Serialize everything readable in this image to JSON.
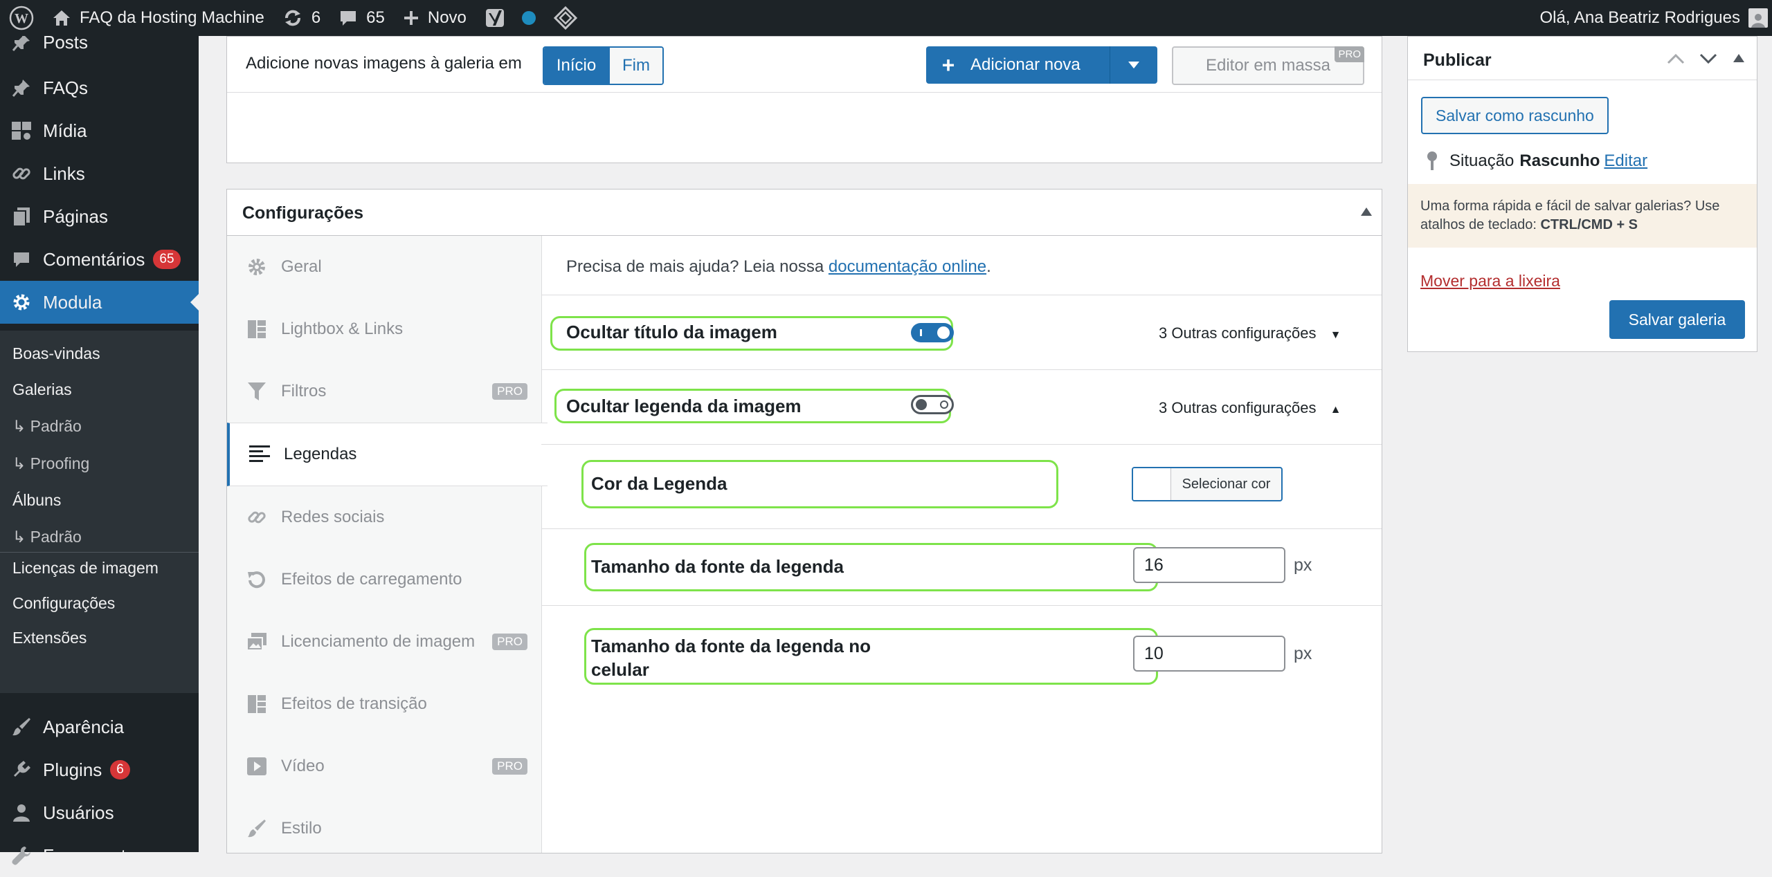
{
  "adminbar": {
    "site_name": "FAQ da Hosting Machine",
    "updates_count": "6",
    "comments_count": "65",
    "new_label": "Novo",
    "greeting": "Olá, Ana Beatriz Rodrigues"
  },
  "menu": {
    "posts": "Posts",
    "faqs": "FAQs",
    "midia": "Mídia",
    "links": "Links",
    "paginas": "Páginas",
    "comentarios": "Comentários",
    "comentarios_badge": "65",
    "modula": "Modula",
    "submenu": {
      "boas_vindas": "Boas-vindas",
      "galerias": "Galerias",
      "padrao1": "↳ Padrão",
      "proofing": "↳ Proofing",
      "albuns": "Álbuns",
      "padrao2": "↳ Padrão",
      "licencas": "Licenças de imagem",
      "configuracoes": "Configurações",
      "extensoes": "Extensões"
    },
    "aparencia": "Aparência",
    "plugins": "Plugins",
    "plugins_badge": "6",
    "usuarios": "Usuários",
    "ferramentas": "Ferramentas"
  },
  "gallery_toolbar": {
    "add_images_text": "Adicione novas imagens à galeria em",
    "inicio": "Início",
    "fim": "Fim",
    "add_new": "Adicionar nova",
    "bulk_editor": "Editor em massa",
    "pro": "PRO"
  },
  "config": {
    "title": "Configurações",
    "help_text": "Precisa de mais ajuda? Leia nossa ",
    "help_link": "documentação online",
    "help_end": ".",
    "tabs": [
      {
        "label": "Geral"
      },
      {
        "label": "Lightbox & Links"
      },
      {
        "label": "Filtros",
        "pro": "PRO"
      },
      {
        "label": "Legendas"
      },
      {
        "label": "Redes sociais"
      },
      {
        "label": "Efeitos de carregamento"
      },
      {
        "label": "Licenciamento de imagem",
        "pro": "PRO"
      },
      {
        "label": "Efeitos de transição"
      },
      {
        "label": "Vídeo",
        "pro": "PRO"
      },
      {
        "label": "Estilo"
      }
    ],
    "settings": {
      "hide_title": "Ocultar título da imagem",
      "hide_title_on": true,
      "hide_caption": "Ocultar legenda da imagem",
      "hide_caption_on": false,
      "other_settings": "3 Outras configurações",
      "caption_color": "Cor da Legenda",
      "select_color": "Selecionar cor",
      "font_size": "Tamanho da fonte da legenda",
      "font_size_value": "16",
      "mobile_font_size": "Tamanho da fonte da legenda no celular",
      "mobile_font_size_value": "10",
      "unit": "px"
    }
  },
  "publish": {
    "title": "Publicar",
    "save_draft": "Salvar como rascunho",
    "status_label": "Situação",
    "status_value": "Rascunho",
    "edit": "Editar",
    "tip": "Uma forma rápida e fácil de salvar galerias? Use atalhos de teclado: ",
    "shortcut": "CTRL/CMD + S",
    "trash": "Mover para a lixeira",
    "save_gallery": "Salvar galeria"
  },
  "colors": {
    "accent": "#2271b1",
    "highlight": "#7ee34a",
    "admin_dark": "#1d2327",
    "danger": "#d63638"
  }
}
